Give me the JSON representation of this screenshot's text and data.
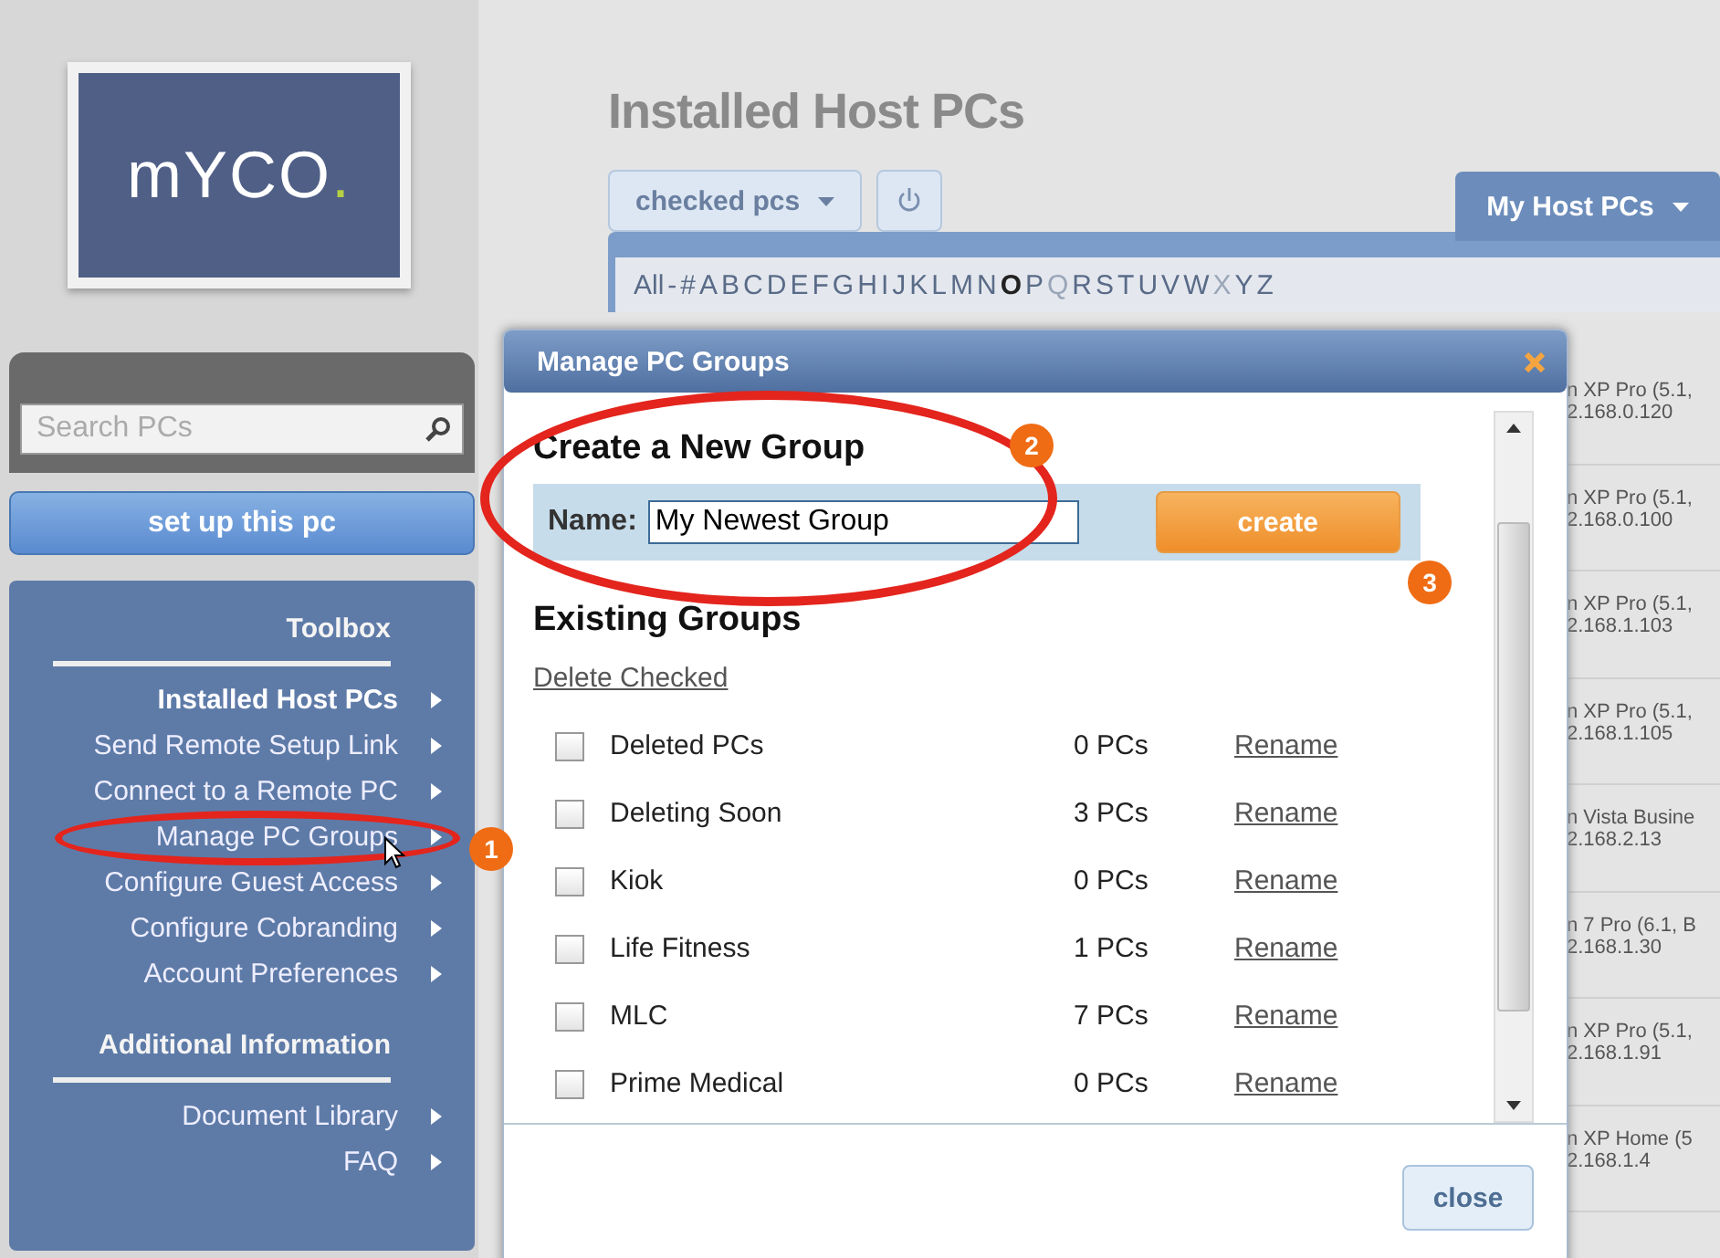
{
  "logo": {
    "text": "mYCO",
    "dot": "."
  },
  "search": {
    "placeholder": "Search PCs"
  },
  "setup_button": "set up this pc",
  "toolbox": {
    "title": "Toolbox",
    "items": [
      {
        "label": "Installed Host PCs",
        "selected": true
      },
      {
        "label": "Send Remote Setup Link",
        "selected": false
      },
      {
        "label": "Connect to a Remote PC",
        "selected": false
      },
      {
        "label": "Manage PC Groups",
        "selected": false
      },
      {
        "label": "Configure Guest Access",
        "selected": false
      },
      {
        "label": "Configure Cobranding",
        "selected": false
      },
      {
        "label": "Account Preferences",
        "selected": false
      }
    ]
  },
  "additional": {
    "title": "Additional Information",
    "items": [
      {
        "label": "Document Library"
      },
      {
        "label": "FAQ"
      }
    ]
  },
  "page_title": "Installed Host PCs",
  "checked_button": "checked pcs",
  "host_tab": "My Host PCs",
  "letters": [
    {
      "text": "All",
      "selected": false,
      "disabled": false
    },
    {
      "text": "-",
      "selected": false,
      "disabled": false
    },
    {
      "text": "#",
      "selected": false,
      "disabled": false
    },
    {
      "text": "A",
      "selected": false,
      "disabled": false
    },
    {
      "text": "B",
      "selected": false,
      "disabled": false
    },
    {
      "text": "C",
      "selected": false,
      "disabled": false
    },
    {
      "text": "D",
      "selected": false,
      "disabled": false
    },
    {
      "text": "E",
      "selected": false,
      "disabled": false
    },
    {
      "text": "F",
      "selected": false,
      "disabled": false
    },
    {
      "text": "G",
      "selected": false,
      "disabled": false
    },
    {
      "text": "H",
      "selected": false,
      "disabled": false
    },
    {
      "text": "I",
      "selected": false,
      "disabled": false
    },
    {
      "text": "J",
      "selected": false,
      "disabled": false
    },
    {
      "text": "K",
      "selected": false,
      "disabled": false
    },
    {
      "text": "L",
      "selected": false,
      "disabled": false
    },
    {
      "text": "M",
      "selected": false,
      "disabled": false
    },
    {
      "text": "N",
      "selected": false,
      "disabled": false
    },
    {
      "text": "O",
      "selected": true,
      "disabled": false
    },
    {
      "text": "P",
      "selected": false,
      "disabled": false
    },
    {
      "text": "Q",
      "selected": false,
      "disabled": true
    },
    {
      "text": "R",
      "selected": false,
      "disabled": false
    },
    {
      "text": "S",
      "selected": false,
      "disabled": false
    },
    {
      "text": "T",
      "selected": false,
      "disabled": false
    },
    {
      "text": "U",
      "selected": false,
      "disabled": false
    },
    {
      "text": "V",
      "selected": false,
      "disabled": false
    },
    {
      "text": "W",
      "selected": false,
      "disabled": false
    },
    {
      "text": "X",
      "selected": false,
      "disabled": true
    },
    {
      "text": "Y",
      "selected": false,
      "disabled": false
    },
    {
      "text": "Z",
      "selected": false,
      "disabled": false
    }
  ],
  "hosts": [
    {
      "os": "n XP Pro (5.1,",
      "ip": "2.168.0.120"
    },
    {
      "os": "n XP Pro (5.1,",
      "ip": "2.168.0.100"
    },
    {
      "os": "n XP Pro (5.1,",
      "ip": "2.168.1.103"
    },
    {
      "os": "n XP Pro (5.1,",
      "ip": "2.168.1.105"
    },
    {
      "os": "n Vista Busine",
      "ip": "2.168.2.13"
    },
    {
      "os": "n 7 Pro (6.1, B",
      "ip": "2.168.1.30"
    },
    {
      "os": "n XP Pro (5.1,",
      "ip": "2.168.1.91"
    },
    {
      "os": "n XP Home (5",
      "ip": "2.168.1.4"
    }
  ],
  "dialog": {
    "title": "Manage PC Groups",
    "create_heading": "Create a New Group",
    "name_label": "Name:",
    "name_value": "My Newest Group",
    "create_button": "create",
    "existing_heading": "Existing Groups",
    "delete_link": "Delete Checked",
    "close_button": "close",
    "groups": [
      {
        "name": "Deleted PCs",
        "count": "0 PCs",
        "action": "Rename",
        "checked": false
      },
      {
        "name": "Deleting Soon",
        "count": "3 PCs",
        "action": "Rename",
        "checked": false
      },
      {
        "name": "Kiok",
        "count": "0 PCs",
        "action": "Rename",
        "checked": false
      },
      {
        "name": "Life Fitness",
        "count": "1 PCs",
        "action": "Rename",
        "checked": false
      },
      {
        "name": "MLC",
        "count": "7 PCs",
        "action": "Rename",
        "checked": false
      },
      {
        "name": "Prime Medical",
        "count": "0 PCs",
        "action": "Rename",
        "checked": false
      }
    ]
  },
  "callouts": [
    "1",
    "2",
    "3"
  ]
}
